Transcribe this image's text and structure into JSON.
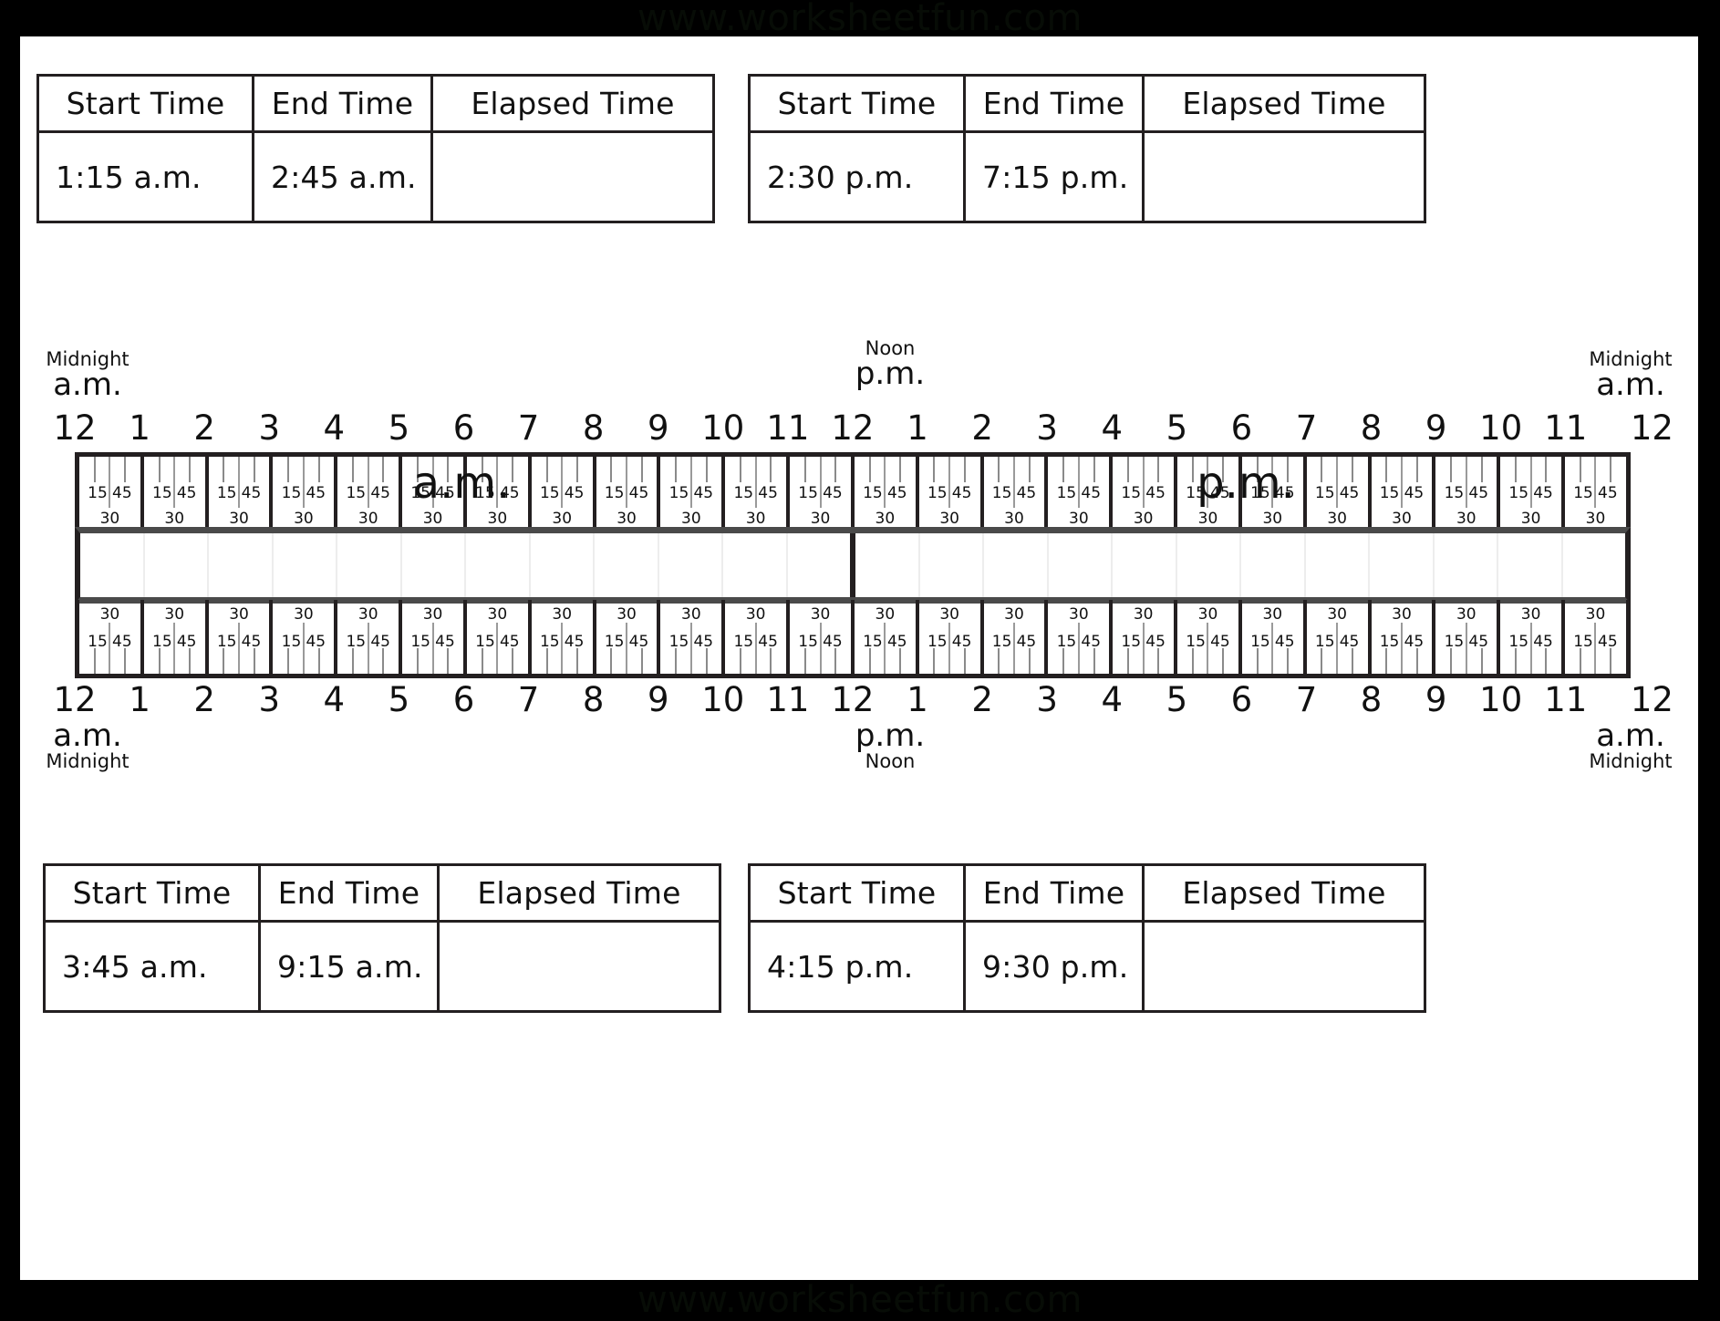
{
  "watermark": {
    "top": "www.worksheetfun.com",
    "bottom": "www.worksheetfun.com"
  },
  "tables": {
    "headers": {
      "start": "Start Time",
      "end": "End Time",
      "elapsed": "Elapsed Time"
    },
    "rows": [
      {
        "id": "top-left",
        "start": "1:15 a.m.",
        "end": "2:45 a.m.",
        "elapsed": ""
      },
      {
        "id": "top-right",
        "start": "2:30 p.m.",
        "end": "7:15 p.m.",
        "elapsed": ""
      },
      {
        "id": "bottom-left",
        "start": "3:45 a.m.",
        "end": "9:15 a.m.",
        "elapsed": ""
      },
      {
        "id": "bottom-right",
        "start": "4:15 p.m.",
        "end": "9:30 p.m.",
        "elapsed": ""
      }
    ]
  },
  "timeline": {
    "captions": {
      "top_left": {
        "note": "Midnight",
        "period": "a.m."
      },
      "top_noon": {
        "note": "Noon",
        "period": "p.m."
      },
      "top_right": {
        "note": "Midnight",
        "period": "a.m."
      },
      "bottom_left": {
        "period": "a.m.",
        "note": "Midnight"
      },
      "bottom_noon": {
        "period": "p.m.",
        "note": "Noon"
      },
      "bottom_right": {
        "period": "a.m.",
        "note": "Midnight"
      }
    },
    "hour_labels": [
      "12",
      "1",
      "2",
      "3",
      "4",
      "5",
      "6",
      "7",
      "8",
      "9",
      "10",
      "11",
      "12",
      "1",
      "2",
      "3",
      "4",
      "5",
      "6",
      "7",
      "8",
      "9",
      "10",
      "11",
      "12"
    ],
    "minute_labels": {
      "q15": "15",
      "q30": "30",
      "q45": "45"
    },
    "half_day_labels": {
      "am": "a.m.",
      "pm": "p.m."
    },
    "hours_count": 24,
    "noon_index": 12
  }
}
